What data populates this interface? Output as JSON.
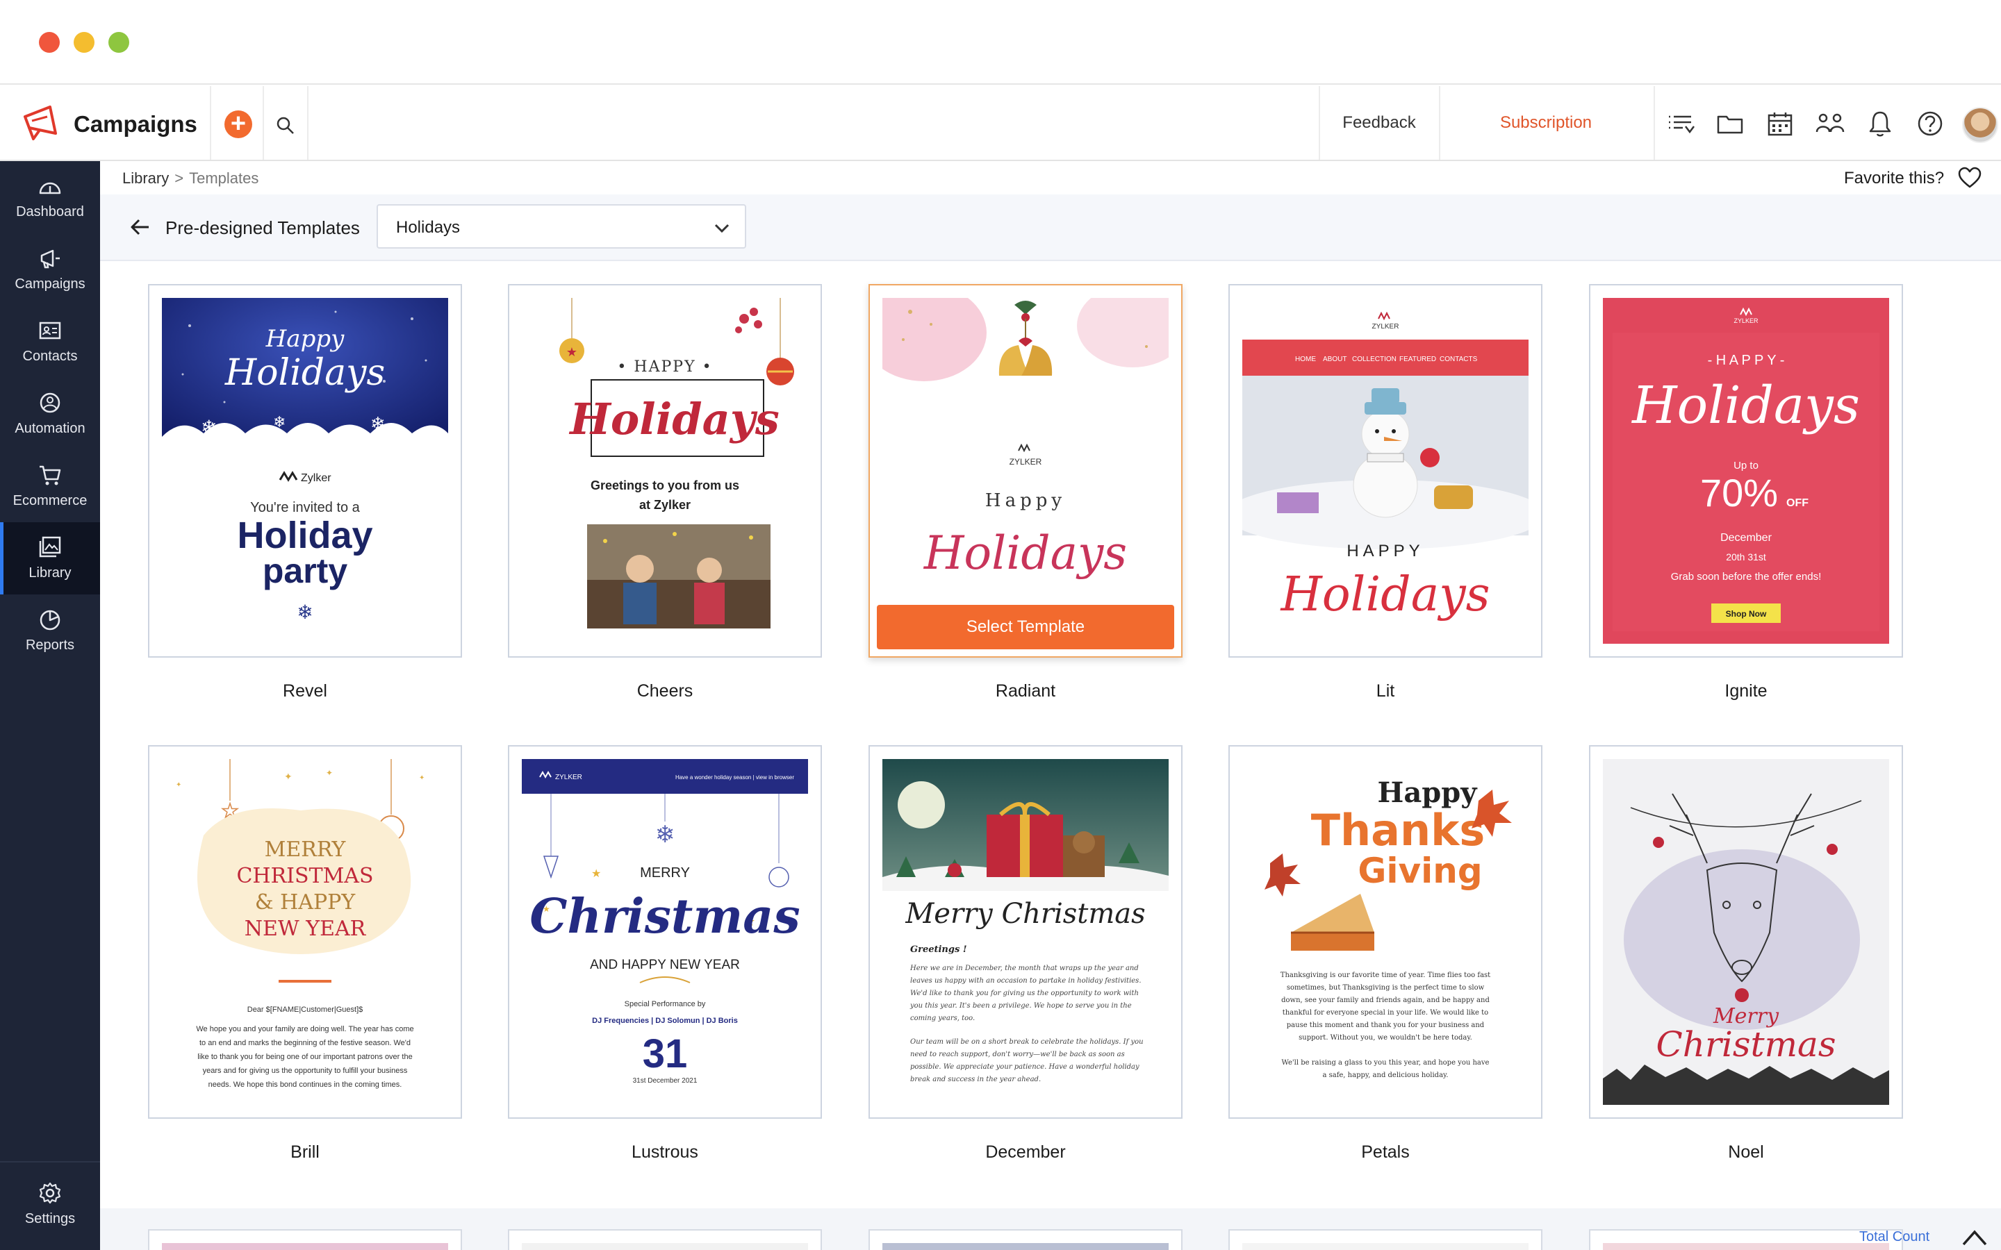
{
  "header": {
    "app_name": "Campaigns",
    "feedback": "Feedback",
    "subscription": "Subscription"
  },
  "sidebar": {
    "items": [
      {
        "label": "Dashboard",
        "icon": "dashboard-icon"
      },
      {
        "label": "Campaigns",
        "icon": "megaphone-icon"
      },
      {
        "label": "Contacts",
        "icon": "contact-card-icon"
      },
      {
        "label": "Automation",
        "icon": "automation-icon"
      },
      {
        "label": "Ecommerce",
        "icon": "cart-icon"
      },
      {
        "label": "Library",
        "icon": "library-icon",
        "active": true
      },
      {
        "label": "Reports",
        "icon": "pie-chart-icon"
      }
    ],
    "settings": "Settings"
  },
  "breadcrumb": {
    "root": "Library",
    "separator": ">",
    "current": "Templates"
  },
  "favorite_label": "Favorite this?",
  "toolbar": {
    "title": "Pre-designed Templates",
    "category": "Holidays"
  },
  "select_button": "Select Template",
  "templates": [
    {
      "name": "Revel",
      "thumb": {
        "line1": "Happy",
        "line2": "Holidays",
        "brand": "Zylker",
        "invite": "You're invited to a",
        "big1": "Holiday",
        "big2": "party"
      }
    },
    {
      "name": "Cheers",
      "thumb": {
        "top": "• HAPPY •",
        "script": "Holidays",
        "greet1": "Greetings to you from us",
        "greet2": "at Zylker"
      }
    },
    {
      "name": "Radiant",
      "thumb": {
        "brand": "ZYLKER",
        "happy": "Happy",
        "script": "Holidays"
      }
    },
    {
      "name": "Lit",
      "thumb": {
        "brand": "ZYLKER",
        "nav": [
          "HOME",
          "ABOUT",
          "COLLECTION",
          "FEATURED",
          "CONTACTS"
        ],
        "happy": "HAPPY",
        "script": "Holidays"
      }
    },
    {
      "name": "Ignite",
      "thumb": {
        "brand": "ZYLKER",
        "happy": "- H A P P Y -",
        "script": "Holidays",
        "upto": "Up to",
        "pct": "70%",
        "off": "OFF",
        "month": "December",
        "range": "20th 31st",
        "tagline": "Grab soon before the offer ends!",
        "cta": "Shop Now"
      }
    },
    {
      "name": "Brill",
      "thumb": {
        "l1": "MERRY",
        "l2": "CHRISTMAS",
        "l3": "& HAPPY",
        "l4": "NEW YEAR",
        "dear": "Dear $[FNAME|Customer|Guest]$",
        "b1": "We hope you and your family are doing well. The year has come",
        "b2": "to an end and marks the beginning of the festive season. We'd",
        "b3": "like to thank you for being one of our important patrons over the",
        "b4": "years and for giving us the opportunity to fulfill your business",
        "b5": "needs. We hope this bond continues in the coming times."
      }
    },
    {
      "name": "Lustrous",
      "thumb": {
        "brand": "ZYLKER",
        "banner": "Have a wonder holiday season | view in browser",
        "merry": "MERRY",
        "script": "Christmas",
        "and": "AND HAPPY NEW YEAR",
        "perf": "Special Performance by",
        "djs": "DJ Frequencies | DJ Solomun | DJ Boris",
        "day": "31",
        "date": "31st December 2021"
      }
    },
    {
      "name": "December",
      "thumb": {
        "script": "Merry Christmas",
        "greet": "Greetings !",
        "p1": "Here we are in December, the month that wraps up the year and",
        "p2": "leaves us happy with an occasion to partake in holiday festivities.",
        "p3": "We'd like to thank you for giving us the opportunity to work with",
        "p4": "you this year. It's been a privilege. We hope to serve you in the",
        "p5": "coming years, too.",
        "q1": "Our team will be on a short break to celebrate the holidays. If you",
        "q2": "need to reach support, don't worry—we'll be back as soon as",
        "q3": "possible. We appreciate your patience. Have a wonderful holiday",
        "q4": "break and success in the year ahead."
      }
    },
    {
      "name": "Petals",
      "thumb": {
        "happy": "Happy",
        "thanks": "Thanks",
        "giving": "Giving",
        "p1": "Thanksgiving is our favorite time of year. Time flies too fast",
        "p2": "sometimes, but Thanksgiving is the perfect time to slow",
        "p3": "down, see your family and friends again, and be happy and",
        "p4": "thankful for everyone special in your life. We would like to",
        "p5": "pause this moment and thank you for your business and",
        "p6": "support. Without you, we wouldn't be here today.",
        "q1": "We'll be raising a glass to you this year, and hope you have",
        "q2": "a safe, happy, and delicious holiday."
      }
    },
    {
      "name": "Noel",
      "thumb": {
        "merry": "Merry",
        "christmas": "Christmas"
      }
    }
  ],
  "footer": {
    "total_count": "Total Count"
  },
  "colors": {
    "accent": "#f26a2e",
    "sidebar": "#1e2537",
    "link": "#3a6fd8"
  }
}
